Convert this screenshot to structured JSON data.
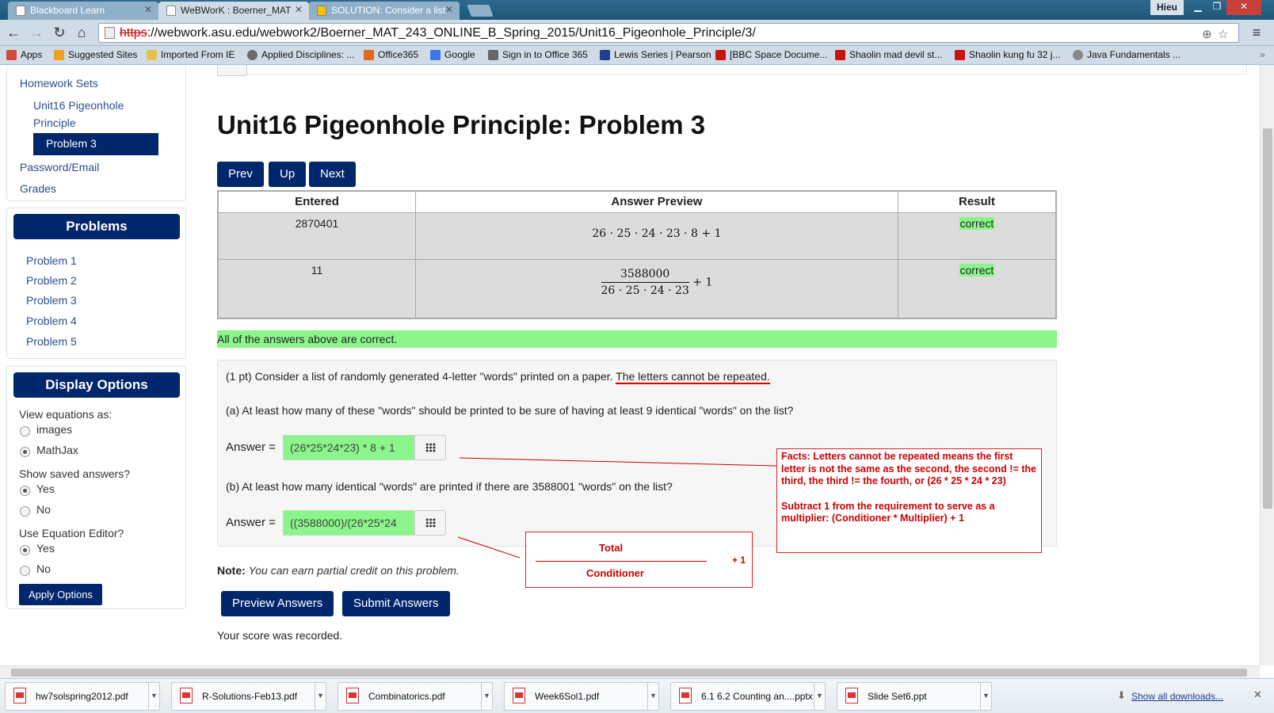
{
  "browser": {
    "tabs": [
      {
        "title": "Blackboard Learn"
      },
      {
        "title": "WeBWorK : Boerner_MAT"
      },
      {
        "title": "SOLUTION: Consider a list"
      }
    ],
    "user": "Hieu",
    "url_scheme": "https",
    "url_rest": "://webwork.asu.edu/webwork2/Boerner_MAT_243_ONLINE_B_Spring_2015/Unit16_Pigeonhole_Principle/3/",
    "bookmarks": [
      {
        "label": "Apps",
        "color": "#d04a3a"
      },
      {
        "label": "Suggested Sites",
        "color": "#f0a020"
      },
      {
        "label": "Imported From IE",
        "color": "#e8c050"
      },
      {
        "label": "Applied Disciplines: ...",
        "color": "#6a6a6a"
      },
      {
        "label": "Office365",
        "color": "#e26a20"
      },
      {
        "label": "Google",
        "color": "#3b78e7"
      },
      {
        "label": "Sign in to Office 365",
        "color": "#666666"
      },
      {
        "label": "Lewis Series | Pearson",
        "color": "#1f3f8a"
      },
      {
        "label": "[BBC Space Docume...",
        "color": "#cc1111"
      },
      {
        "label": "Shaolin mad devil st...",
        "color": "#cc1111"
      },
      {
        "label": "Shaolin kung fu 32 j...",
        "color": "#cc1111"
      },
      {
        "label": "Java Fundamentals ...",
        "color": "#888888"
      }
    ]
  },
  "sidebar": {
    "homework_sets": "Homework Sets",
    "set_line1": "Unit16 Pigeonhole",
    "set_line2": "Principle",
    "active_problem": "Problem 3",
    "password": "Password/Email",
    "grades": "Grades",
    "problems_title": "Problems",
    "problems": [
      "Problem 1",
      "Problem 2",
      "Problem 3",
      "Problem 4",
      "Problem 5"
    ],
    "display_title": "Display Options",
    "view_eq": "View equations as:",
    "opt_images": "images",
    "opt_mathjax": "MathJax",
    "show_saved": "Show saved answers?",
    "yes": "Yes",
    "no": "No",
    "use_editor": "Use Equation Editor?",
    "apply": "Apply Options"
  },
  "main": {
    "title": "Unit16 Pigeonhole Principle: Problem 3",
    "nav": {
      "prev": "Prev",
      "up": "Up",
      "next": "Next"
    },
    "table": {
      "headers": [
        "Entered",
        "Answer Preview",
        "Result"
      ],
      "rows": [
        {
          "entered": "2870401",
          "preview": "26 · 25 · 24 · 23 · 8 + 1",
          "result": "correct"
        },
        {
          "entered": "11",
          "preview_num": "3588000",
          "preview_den": "26 · 25 · 24 · 23",
          "preview_tail": "+ 1",
          "result": "correct"
        }
      ]
    },
    "all_correct": "All of the answers above are correct.",
    "problem": {
      "intro": "(1 pt) Consider a list of randomly generated 4-letter \"words\" printed on a paper. ",
      "intro_underlined": "The letters cannot be repeated.",
      "part_a": "(a) At least how many of these \"words\" should be printed to be sure of having at least 9 identical \"words\" on the list?",
      "answer_label": "Answer =",
      "answer_a": "(26*25*24*23) * 8 + 1",
      "part_b": "(b) At least how many identical \"words\" are printed if there are 3588001 \"words\" on the list?",
      "answer_b": "((3588000)/(26*25*24"
    },
    "note_label": "Note:",
    "note_text": "You can earn partial credit on this problem.",
    "preview_btn": "Preview Answers",
    "submit_btn": "Submit Answers",
    "recorded": "Your score was recorded."
  },
  "annotations": {
    "facts_1": "Facts: Letters cannot be repeated means the first letter is not the same as the second, the second != the third, the third != the fourth, or (26 * 25 * 24 * 23)",
    "facts_2": "Subtract 1 from the requirement to serve as a multiplier: (Conditioner * Multiplier) + 1",
    "total": "Total",
    "conditioner": "Conditioner",
    "plus_one": "+ 1"
  },
  "downloads": {
    "files": [
      "hw7solspring2012.pdf",
      "R-Solutions-Feb13.pdf",
      "Combinatorics.pdf",
      "Week6Sol1.pdf",
      "6.1 6.2 Counting an....pptx",
      "Slide Set6.ppt"
    ],
    "show_all": "Show all downloads..."
  }
}
